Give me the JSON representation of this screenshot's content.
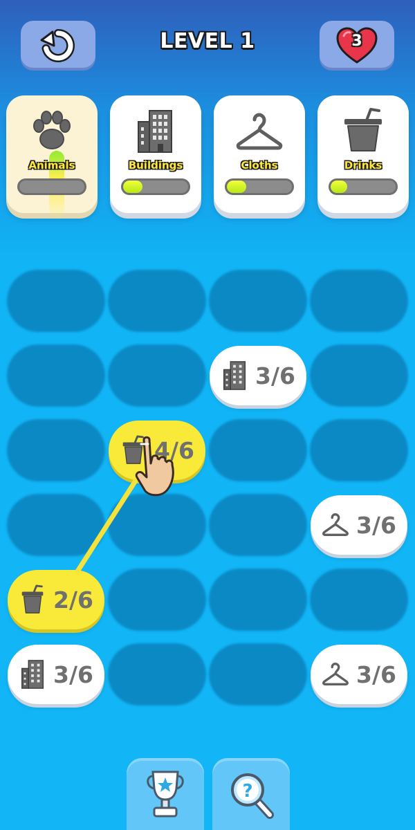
{
  "header": {
    "level_title": "LEVEL 1",
    "lives": "3",
    "restart_icon": "restart-icon",
    "heart_icon": "heart-icon"
  },
  "categories": [
    {
      "label": "Animals",
      "icon": "paw-icon",
      "progress": 0.0,
      "active": true
    },
    {
      "label": "Buildings",
      "icon": "building-icon",
      "progress": 0.3,
      "active": false
    },
    {
      "label": "Cloths",
      "icon": "hanger-icon",
      "progress": 0.3,
      "active": false
    },
    {
      "label": "Drinks",
      "icon": "cup-icon",
      "progress": 0.25,
      "active": false
    }
  ],
  "board": {
    "rows": 6,
    "cols": 4,
    "tiles": [
      {
        "row": 1,
        "col": 2,
        "icon": "building-icon",
        "count": "3/6",
        "selected": false
      },
      {
        "row": 2,
        "col": 1,
        "icon": "cup-icon",
        "count": "4/6",
        "selected": true
      },
      {
        "row": 3,
        "col": 3,
        "icon": "hanger-icon",
        "count": "3/6",
        "selected": false
      },
      {
        "row": 4,
        "col": 0,
        "icon": "cup-icon",
        "count": "2/6",
        "selected": true
      },
      {
        "row": 5,
        "col": 0,
        "icon": "building-icon",
        "count": "3/6",
        "selected": false
      },
      {
        "row": 5,
        "col": 3,
        "icon": "hanger-icon",
        "count": "3/6",
        "selected": false
      }
    ]
  },
  "bottom_buttons": [
    {
      "name": "trophy-button",
      "icon": "trophy-icon"
    },
    {
      "name": "hint-button",
      "icon": "magnifier-hint-icon"
    }
  ],
  "colors": {
    "accent_yellow": "#f9ea3a",
    "board_blue": "#12b6f7",
    "slot_blue": "#0b87c3",
    "header_blue": "#2f5fbb",
    "heart_red": "#e8354a"
  }
}
